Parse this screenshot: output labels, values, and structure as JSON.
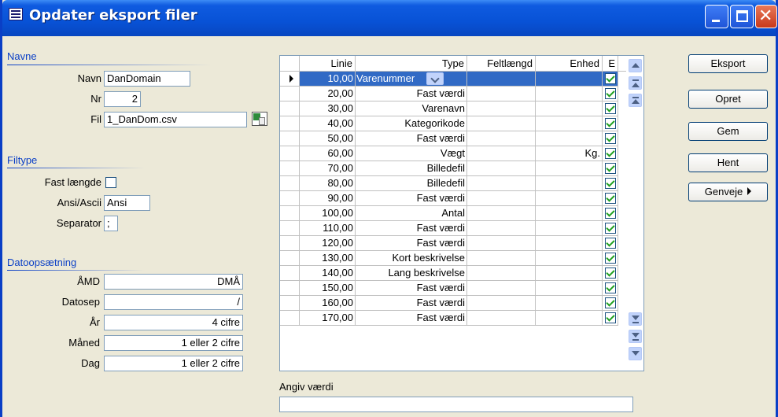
{
  "window": {
    "title": "Opdater eksport filer",
    "close_glyph": "✕"
  },
  "navne": {
    "section": "Navne",
    "navn_label": "Navn",
    "navn_value": "DanDomain",
    "nr_label": "Nr",
    "nr_value": "2",
    "fil_label": "Fil",
    "fil_value": "1_DanDom.csv"
  },
  "filtype": {
    "section": "Filtype",
    "fast_label": "Fast længde",
    "ansi_label": "Ansi/Ascii",
    "ansi_value": "Ansi",
    "sep_label": "Separator",
    "sep_value": ";"
  },
  "dato": {
    "section": "Datoopsætning",
    "rows": [
      {
        "label": "ÅMD",
        "value": "DMÅ"
      },
      {
        "label": "Datosep",
        "value": "/"
      },
      {
        "label": "År",
        "value": "4 cifre"
      },
      {
        "label": "Måned",
        "value": "1 eller 2 cifre"
      },
      {
        "label": "Dag",
        "value": "1 eller 2 cifre"
      }
    ]
  },
  "grid": {
    "headers": {
      "linie": "Linie",
      "type": "Type",
      "feltlaengd": "Feltlængd",
      "enhed": "Enhed",
      "e": "E"
    },
    "rows": [
      {
        "linie": "10,00",
        "type": "Varenummer",
        "enhed": ""
      },
      {
        "linie": "20,00",
        "type": "Fast værdi",
        "enhed": ""
      },
      {
        "linie": "30,00",
        "type": "Varenavn",
        "enhed": ""
      },
      {
        "linie": "40,00",
        "type": "Kategorikode",
        "enhed": ""
      },
      {
        "linie": "50,00",
        "type": "Fast værdi",
        "enhed": ""
      },
      {
        "linie": "60,00",
        "type": "Vægt",
        "enhed": "Kg."
      },
      {
        "linie": "70,00",
        "type": "Billedefil",
        "enhed": ""
      },
      {
        "linie": "80,00",
        "type": "Billedefil",
        "enhed": ""
      },
      {
        "linie": "90,00",
        "type": "Fast værdi",
        "enhed": ""
      },
      {
        "linie": "100,00",
        "type": "Antal",
        "enhed": ""
      },
      {
        "linie": "110,00",
        "type": "Fast værdi",
        "enhed": ""
      },
      {
        "linie": "120,00",
        "type": "Fast værdi",
        "enhed": ""
      },
      {
        "linie": "130,00",
        "type": "Kort beskrivelse",
        "enhed": ""
      },
      {
        "linie": "140,00",
        "type": "Lang beskrivelse",
        "enhed": ""
      },
      {
        "linie": "150,00",
        "type": "Fast værdi",
        "enhed": ""
      },
      {
        "linie": "160,00",
        "type": "Fast værdi",
        "enhed": ""
      },
      {
        "linie": "170,00",
        "type": "Fast værdi",
        "enhed": ""
      }
    ]
  },
  "angiv": {
    "label": "Angiv værdi",
    "value": ""
  },
  "buttons": {
    "eksport": "Eksport",
    "opret": "Opret",
    "gem": "Gem",
    "hent": "Hent",
    "genveje": "Genveje"
  },
  "colors": {
    "titlebar": "#0852D6",
    "section_title": "#0A3FC6",
    "selection": "#316AC5",
    "check": "#21A121"
  }
}
